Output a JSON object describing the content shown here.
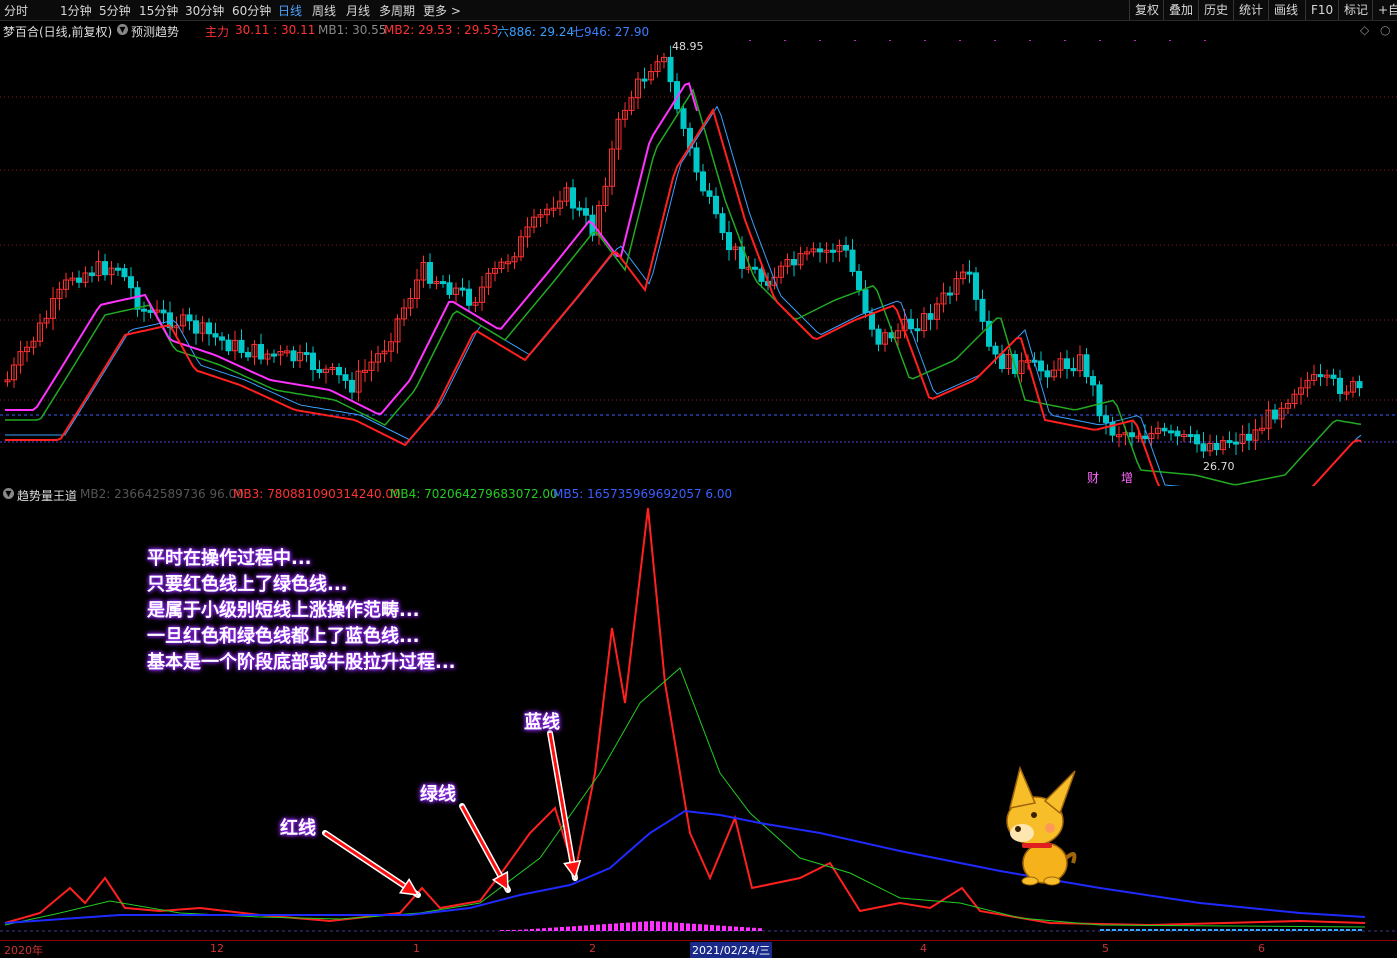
{
  "toolbar": {
    "timeframes": [
      "分时",
      "1分钟",
      "5分钟",
      "15分钟",
      "30分钟",
      "60分钟",
      "日线",
      "周线",
      "月线",
      "多周期",
      "更多 >"
    ],
    "active": "日线",
    "right_buttons": [
      "复权",
      "叠加",
      "历史",
      "统计",
      "画线",
      "F10",
      "标记",
      "+自选"
    ]
  },
  "infobar": {
    "stock": "梦百合(日线,前复权)",
    "predict": "预测趋势",
    "zhuli_label": "主力",
    "zhuli_values": "30.11 : 30.11",
    "mb1": "MB1: 30.55",
    "mb2": "MB2: 29.53 : 29.53",
    "liu": "六886: 29.24",
    "qi": "七946: 27.90"
  },
  "price_chart": {
    "high_label": "48.95",
    "low_label": "26.70",
    "marker_cai": "财",
    "marker_zeng": "增",
    "colors": {
      "up": "#ff3030",
      "down": "#00c8c8",
      "ma_magenta": "#ff33ff",
      "ma_red": "#ff2020",
      "ma_green": "#22aa22",
      "ma_blue": "#3a9fff"
    }
  },
  "indicator": {
    "title": "趋势量王道",
    "mb2": "MB2: 236642589736 96.00",
    "mb3": "MB3: 780881090314240.00",
    "mb4": "MB4: 702064279683072.00",
    "mb5": "MB5: 165735969692057 6.00"
  },
  "annotations": {
    "lines": [
      "平时在操作过程中...",
      "只要红色线上了绿色线...",
      "是属于小级别短线上涨操作范畴...",
      "一旦红色和绿色线都上了蓝色线...",
      "基本是一个阶段底部或牛股拉升过程..."
    ],
    "red_tag": "红线",
    "green_tag": "绿线",
    "blue_tag": "蓝线"
  },
  "xaxis": {
    "labels": [
      "2020年",
      "12",
      "1",
      "2",
      "2021/02/24/三",
      "4",
      "5",
      "6"
    ]
  }
}
